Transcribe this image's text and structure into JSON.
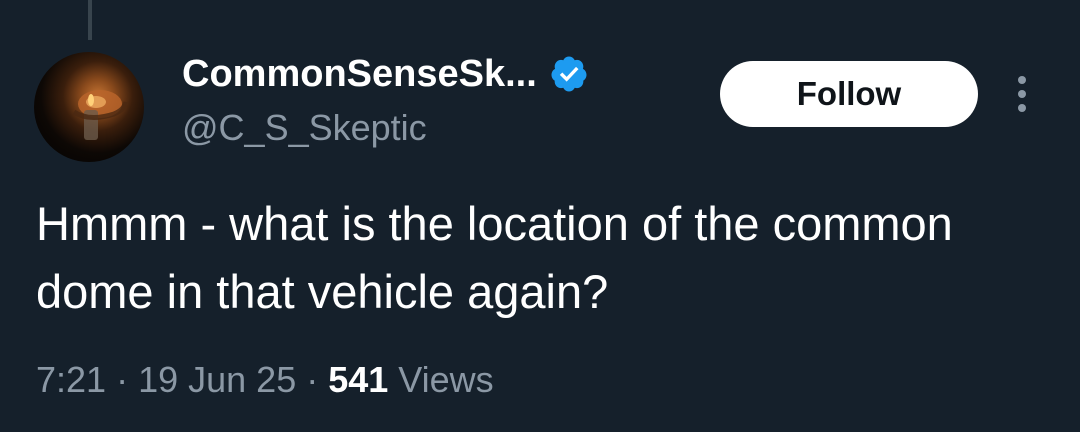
{
  "author": {
    "display_name": "CommonSenseSk...",
    "handle": "@C_S_Skeptic",
    "verified": true,
    "avatar_icon": "candle-in-hand-avatar"
  },
  "actions": {
    "follow_label": "Follow",
    "more_icon": "vertical-ellipsis-icon"
  },
  "tweet": {
    "text": "Hmmm - what is the location of the common dome in that vehicle again?",
    "time": "7:21",
    "separator": "·",
    "date": "19 Jun 25",
    "views_count": "541",
    "views_label": "Views"
  },
  "colors": {
    "background": "#15202b",
    "text_primary": "#ffffff",
    "text_secondary": "#8b98a5",
    "verified_badge": "#1d9bf0",
    "thread_line": "#38444d"
  }
}
